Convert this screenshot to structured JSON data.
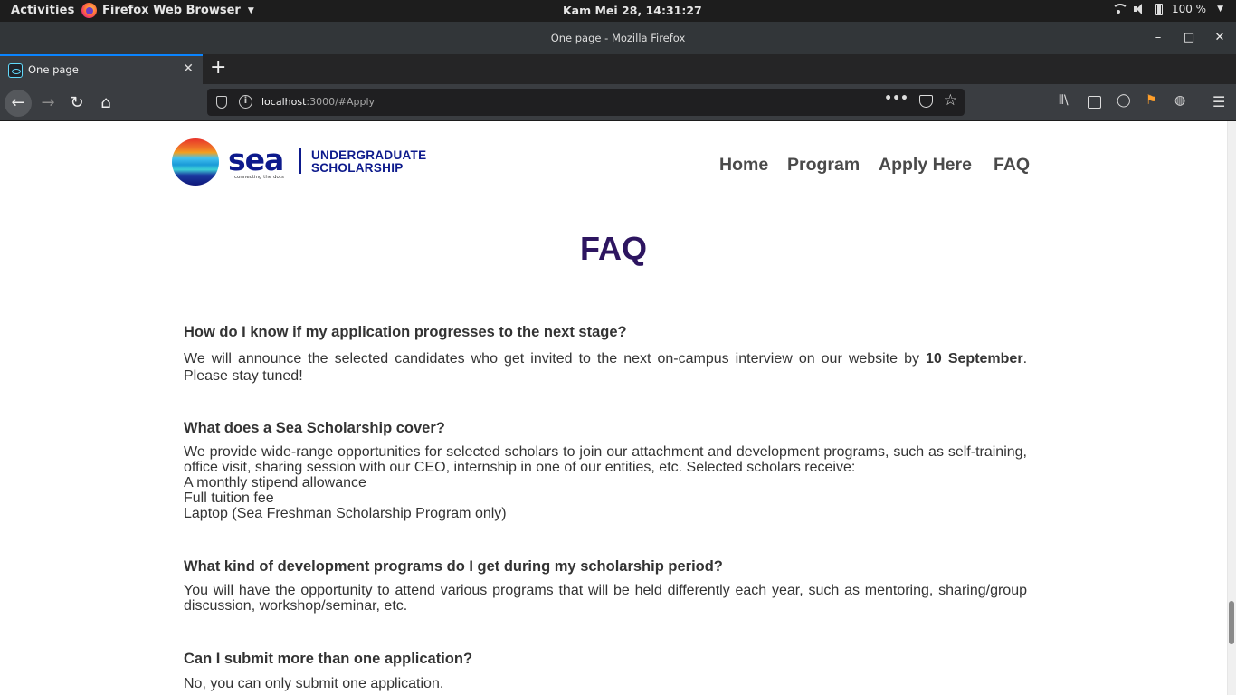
{
  "system": {
    "activities": "Activities",
    "app_name": "Firefox Web Browser",
    "clock": "Kam Mei 28, 14:31:27",
    "battery": "100 %"
  },
  "window": {
    "title": "One page - Mozilla Firefox",
    "minimize": "–",
    "maximize": "□",
    "close": "✕"
  },
  "tabs": [
    {
      "title": "One page",
      "close": "✕"
    }
  ],
  "newtab": "+",
  "nav_buttons": {
    "back": "←",
    "forward": "→",
    "reload": "↻",
    "home": "⌂"
  },
  "url": {
    "host": "localhost",
    "rest": ":3000/#Apply"
  },
  "toolbar": {
    "page_actions": "•••",
    "bookmark_star": "☆",
    "library": "⫴\\",
    "menu": "☰",
    "account": "◯",
    "ext1": "⚑",
    "ext2": "◍"
  },
  "site": {
    "logo": {
      "word": "sea",
      "tagline": "connecting the dots",
      "line1": "UNDERGRADUATE",
      "line2": "SCHOLARSHIP"
    },
    "nav": [
      "Home",
      "Program",
      "Apply Here",
      "FAQ"
    ]
  },
  "faq": {
    "title": "FAQ",
    "items": [
      {
        "question": "How do I know if my application progresses to the next stage?",
        "answer_pre": "We will announce the selected candidates who get invited to the next on-campus interview on our website by ",
        "answer_bold": "10 September",
        "answer_post": ". Please stay tuned!"
      },
      {
        "question": "What does a Sea Scholarship cover?",
        "answer": "We provide wide-range opportunities for selected scholars to join our attachment and development programs, such as self-training, office visit, sharing session with our CEO, internship in one of our entities, etc. Selected scholars receive:",
        "bullets": [
          "A monthly stipend allowance",
          "Full tuition fee",
          "Laptop (Sea Freshman Scholarship Program only)"
        ]
      },
      {
        "question": "What kind of development programs do I get during my scholarship period?",
        "answer": "You will have the opportunity to attend various programs that will be held differently each year, such as mentoring, sharing/group discussion, workshop/seminar, etc."
      },
      {
        "question": "Can I submit more than one application?",
        "answer": "No, you can only submit one application."
      }
    ]
  }
}
